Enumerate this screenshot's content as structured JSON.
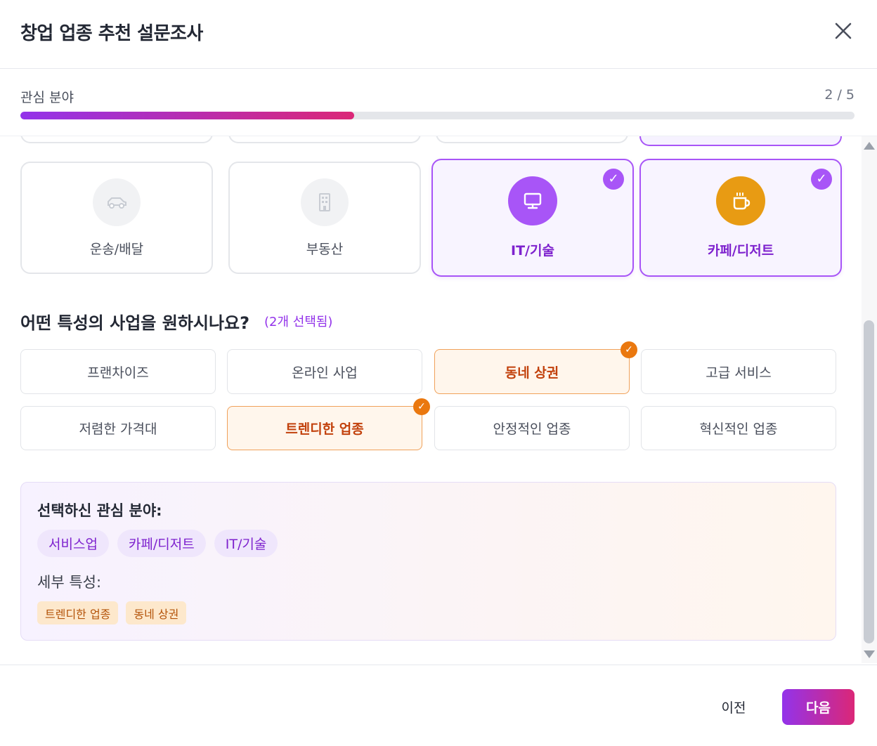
{
  "header": {
    "title": "창업 업종 추천 설문조사",
    "close_icon": "close-icon"
  },
  "progress": {
    "label": "관심 분야",
    "count": "2 / 5",
    "fraction": 0.4,
    "colors": [
      "#9333ea",
      "#db2777"
    ]
  },
  "categories": [
    {
      "label": "운송/배달",
      "icon": "car-icon",
      "selected": false
    },
    {
      "label": "부동산",
      "icon": "building-icon",
      "selected": false
    },
    {
      "label": "IT/기술",
      "icon": "monitor-icon",
      "selected": true,
      "icon_color": "#a855f7"
    },
    {
      "label": "카페/디저트",
      "icon": "coffee-cup-icon",
      "selected": true,
      "icon_color": "#e89b13"
    }
  ],
  "check_mark": "✓",
  "question": {
    "text": "어떤 특성의 사업을 원하시나요?",
    "count": "(2개 선택됨)"
  },
  "traits": [
    {
      "label": "프랜차이즈",
      "selected": false
    },
    {
      "label": "온라인 사업",
      "selected": false
    },
    {
      "label": "동네 상권",
      "selected": true
    },
    {
      "label": "고급 서비스",
      "selected": false
    },
    {
      "label": "저렴한 가격대",
      "selected": false
    },
    {
      "label": "트렌디한 업종",
      "selected": true
    },
    {
      "label": "안정적인 업종",
      "selected": false
    },
    {
      "label": "혁신적인 업종",
      "selected": false
    }
  ],
  "summary": {
    "interests_heading": "선택하신 관심 분야:",
    "interests": [
      "서비스업",
      "카페/디저트",
      "IT/기술"
    ],
    "traits_heading": "세부 특성:",
    "traits": [
      "트렌디한 업종",
      "동네 상권"
    ]
  },
  "footer": {
    "prev_label": "이전",
    "next_label": "다음"
  }
}
